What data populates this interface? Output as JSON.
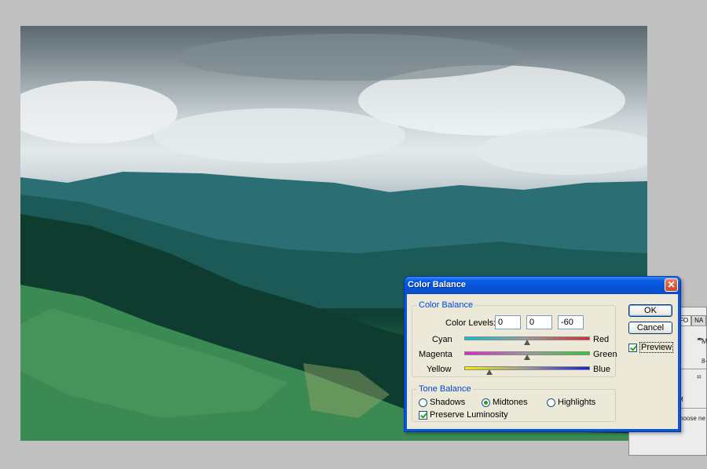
{
  "dialog": {
    "title": "Color Balance",
    "close_glyph": "✕",
    "color_balance": {
      "legend": "Color Balance",
      "levels_label": "Color Levels:",
      "levels": [
        "0",
        "0",
        "-60"
      ],
      "sliders": [
        {
          "left": "Cyan",
          "right": "Red",
          "value": 0,
          "left_color": "#00c4d8",
          "right_color": "#e0262c"
        },
        {
          "left": "Magenta",
          "right": "Green",
          "value": 0,
          "left_color": "#e020d8",
          "right_color": "#2ccb2c"
        },
        {
          "left": "Yellow",
          "right": "Blue",
          "value": -60,
          "left_color": "#f0f000",
          "right_color": "#1a1ad8"
        }
      ]
    },
    "tone_balance": {
      "legend": "Tone Balance",
      "options": [
        "Shadows",
        "Midtones",
        "Highlights"
      ],
      "selected": "Midtones",
      "preserve_luminosity": "Preserve Luminosity",
      "preserve_checked": true
    },
    "buttons": {
      "ok": "OK",
      "cancel": "Cancel"
    },
    "preview": {
      "label": "Preview",
      "checked": true
    }
  },
  "side_panel": {
    "tabs": [
      "FO",
      "NA"
    ],
    "text_8": "8-",
    "text_m": "M",
    "text_choose": "hoose ne"
  },
  "colors": {
    "dialog_frame": "#0a56d8",
    "dialog_face": "#ece9d8",
    "group_legend": "#0046d5",
    "close_button": "#c84a23"
  }
}
